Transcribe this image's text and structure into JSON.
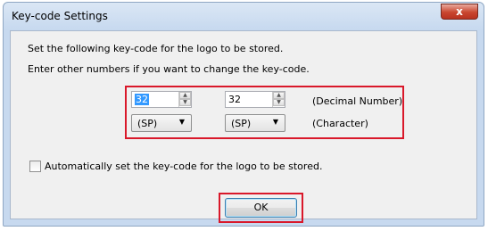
{
  "dialog": {
    "title": "Key-code Settings",
    "close_label": "x"
  },
  "instructions": {
    "line1": "Set the following key-code for the logo to be stored.",
    "line2": "Enter other numbers if you want to change the key-code."
  },
  "keycode": {
    "field1_value": "32",
    "field2_value": "32",
    "combo1_value": "(SP)",
    "combo2_value": "(SP)",
    "decimal_label": "(Decimal Number)",
    "character_label": "(Character)"
  },
  "auto_set": {
    "label": "Automatically set the key-code for the logo to be stored.",
    "checked": false
  },
  "buttons": {
    "ok": "OK"
  },
  "icons": {
    "spin_up": "spin-up-icon",
    "spin_down": "spin-down-icon",
    "dropdown": "dropdown-arrow-icon"
  },
  "colors": {
    "highlight": "#d9182a",
    "selection": "#3399ff"
  }
}
